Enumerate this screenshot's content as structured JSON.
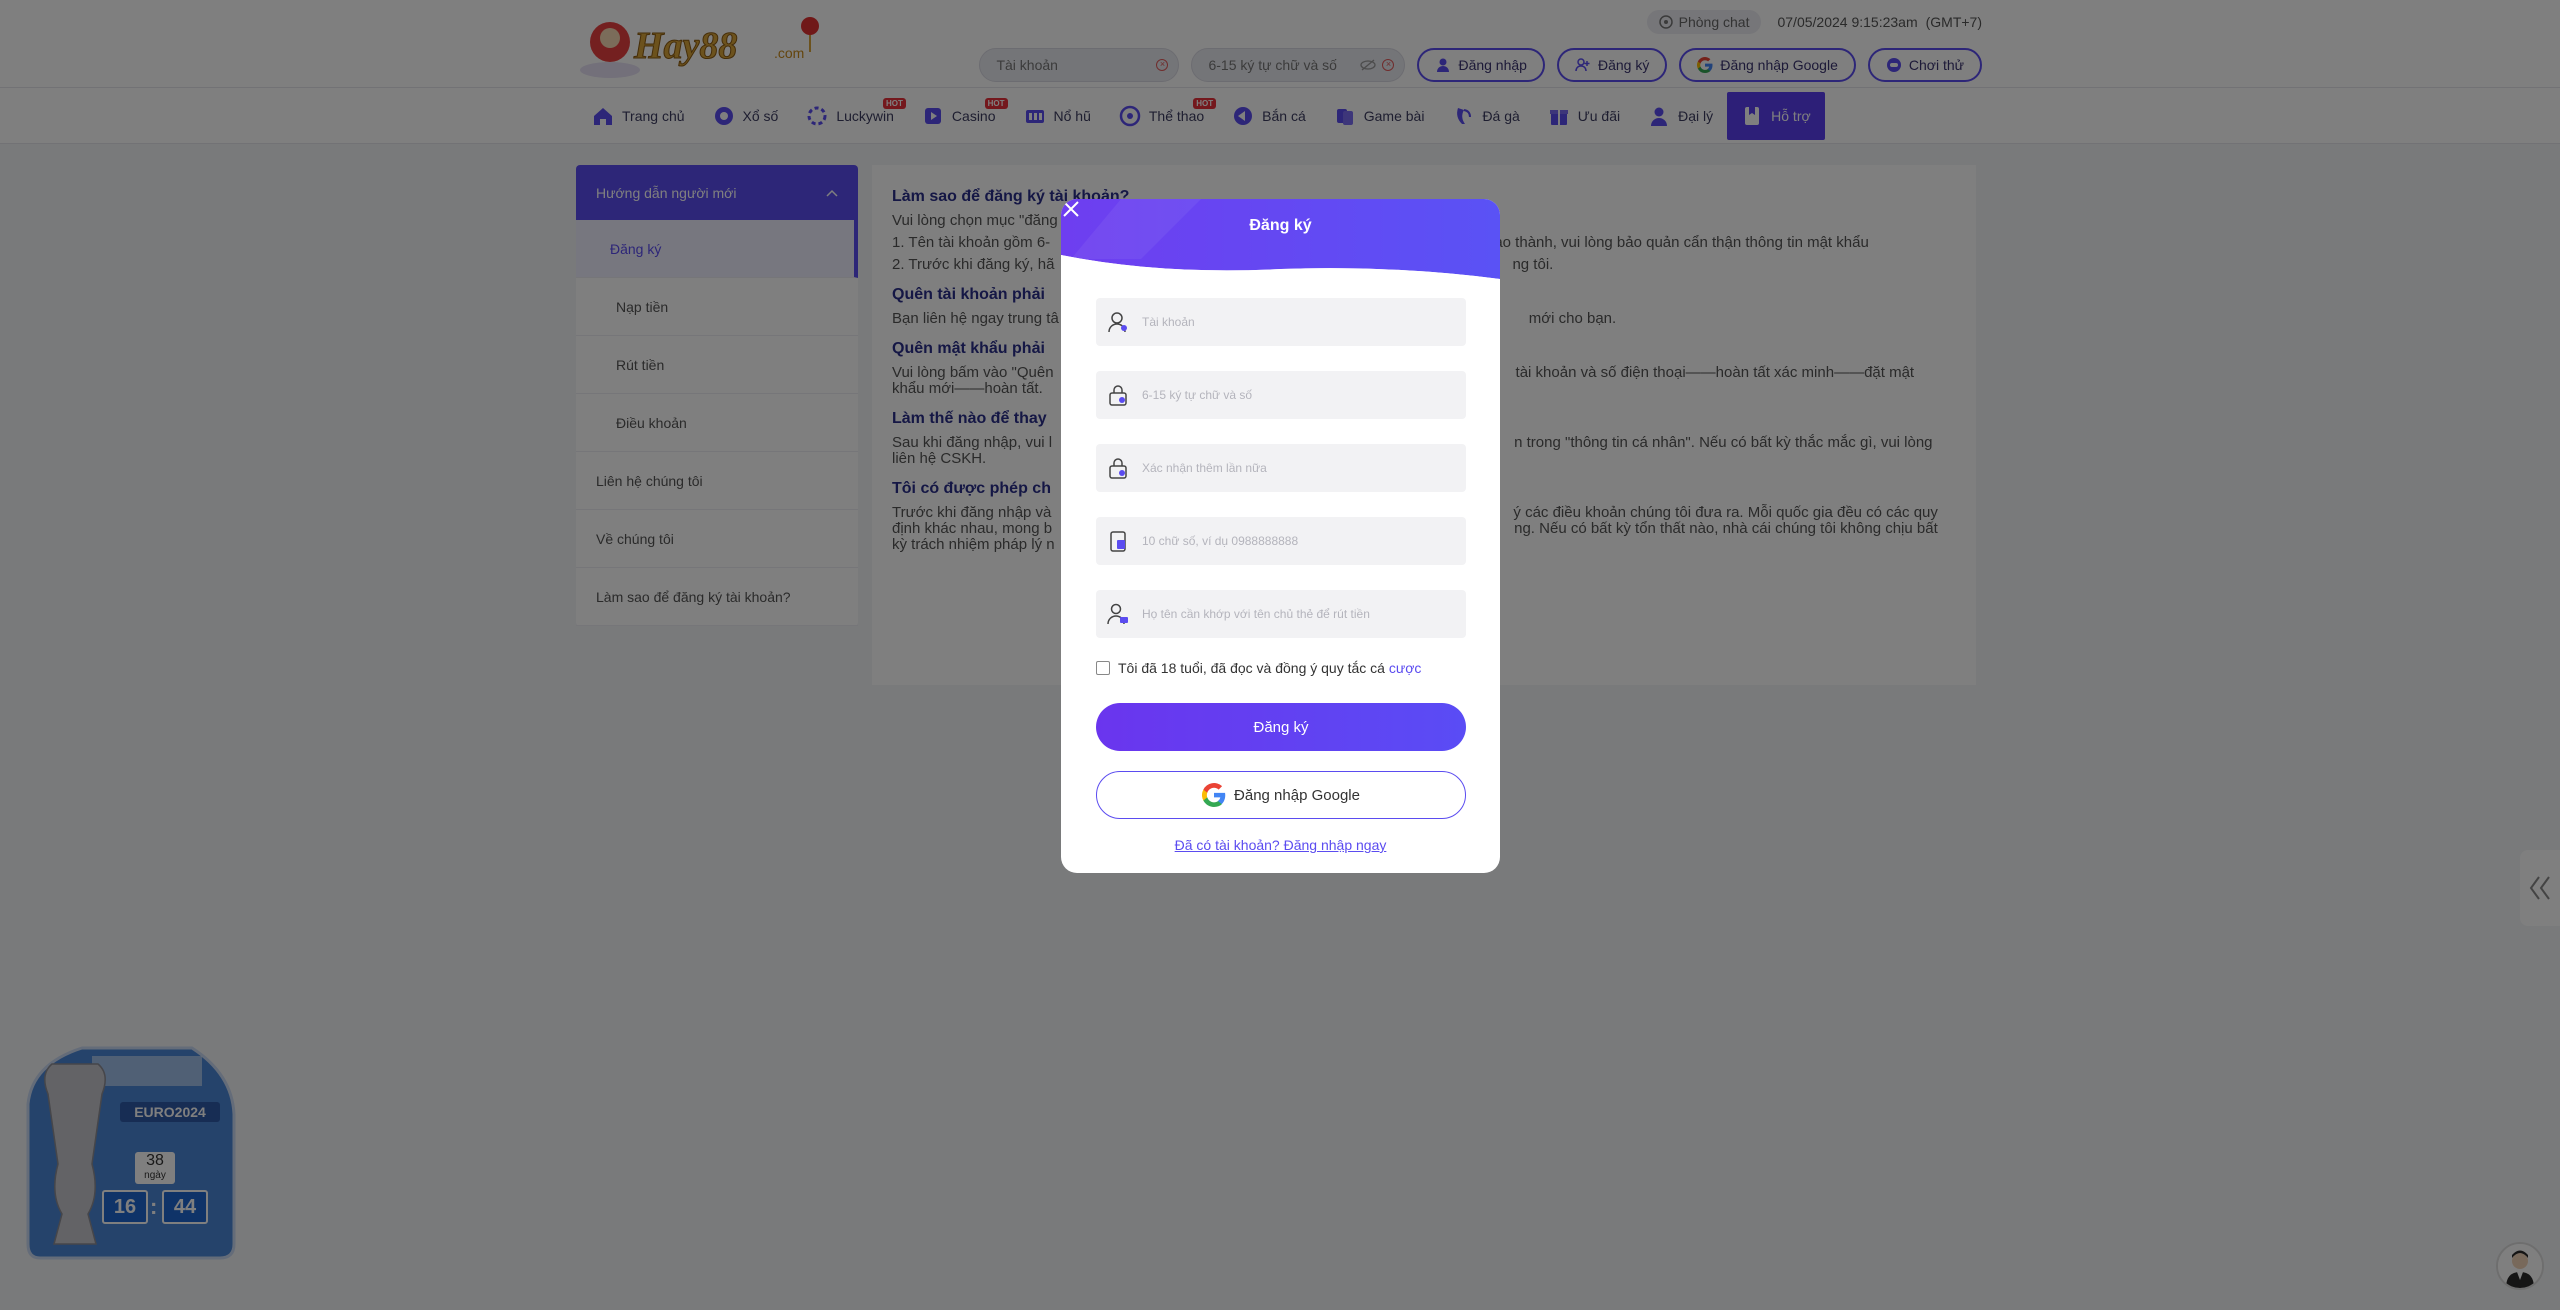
{
  "header": {
    "logo_text": "Hay88.com",
    "chat_label": "Phòng chat",
    "datetime": "07/05/2024 9:15:23am",
    "timezone": "(GMT+7)",
    "username_placeholder": "Tài khoản",
    "password_placeholder": "6-15 ký tự chữ và số",
    "login_label": "Đăng nhập",
    "register_label": "Đăng ký",
    "google_login_label": "Đăng nhập Google",
    "trial_label": "Chơi thử"
  },
  "nav": {
    "items": [
      {
        "label": "Trang chủ",
        "icon": "home-icon"
      },
      {
        "label": "Xổ số",
        "icon": "lottery-icon"
      },
      {
        "label": "Luckywin",
        "icon": "luckywin-icon",
        "badge": "HOT"
      },
      {
        "label": "Casino",
        "icon": "casino-icon",
        "badge": "HOT"
      },
      {
        "label": "Nổ hũ",
        "icon": "slots-icon"
      },
      {
        "label": "Thể thao",
        "icon": "sports-icon",
        "badge": "HOT"
      },
      {
        "label": "Bắn cá",
        "icon": "fish-icon"
      },
      {
        "label": "Game bài",
        "icon": "cards-icon"
      },
      {
        "label": "Đá gà",
        "icon": "cockfight-icon"
      },
      {
        "label": "Ưu đãi",
        "icon": "gift-icon"
      },
      {
        "label": "Đại lý",
        "icon": "agent-icon"
      },
      {
        "label": "Hỗ trợ",
        "icon": "support-icon",
        "active": true
      }
    ]
  },
  "sidebar": {
    "section_title": "Hướng dẫn người mới",
    "sub_items": [
      "Đăng ký",
      "Nạp tiền",
      "Rút tiền",
      "Điều khoản"
    ],
    "top_items": [
      "Liên hệ chúng tôi",
      "Về chúng tôi",
      "Làm sao để đăng ký tài khoản?"
    ]
  },
  "content": {
    "q1": "Làm sao để đăng ký tài khoản?",
    "p1a": "Vui lòng chọn mục \"đăng",
    "p1b": "1. Tên tài khoản gồm 6-",
    "p1b_tail": "số tạo thành, vui lòng bảo quản cẩn thận thông tin mật khẩu",
    "p1c": "2. Trước khi đăng ký, hã",
    "p1c_tail": "ng tôi.",
    "q2": "Quên tài khoản phải",
    "p2": "Bạn liên hệ ngay trung tâ",
    "p2_tail": "mới cho bạn.",
    "q3": "Quên mật khẩu phải",
    "p3": "Vui lòng bấm vào \"Quên",
    "p3_tail": "tài khoản và số điện thoại——hoàn tất xác minh——đặt mật",
    "p3_line2": "khẩu mới——hoàn tất.",
    "q4": "Làm thế nào để thay",
    "p4": "Sau khi đăng nhập, vui l",
    "p4_tail": "n trong \"thông tin cá nhân\". Nếu có bất kỳ thắc mắc gì, vui lòng",
    "p4_line2": "liên hệ CSKH.",
    "q5": "Tôi có được phép ch",
    "p5": "Trước khi đăng nhập và",
    "p5_tail": "ý các điều khoản chúng tôi đưa ra. Mỗi quốc gia đều có các quy",
    "p5_line2": "định khác nhau, mong b",
    "p5_line2_tail": "ng. Nếu có bất kỳ tổn thất nào, nhà cái chúng tôi không chịu bất",
    "p5_line3": "kỳ trách nhiệm pháp lý n"
  },
  "modal": {
    "title": "Đăng ký",
    "fields": [
      {
        "icon": "user-icon",
        "placeholder": "Tài khoản"
      },
      {
        "icon": "lock-icon",
        "placeholder": "6-15 ký tự chữ và số"
      },
      {
        "icon": "lock-icon",
        "placeholder": "Xác nhận thêm lần nữa"
      },
      {
        "icon": "phone-icon",
        "placeholder": "10 chữ số, ví dụ 0988888888"
      },
      {
        "icon": "id-user-icon",
        "placeholder": "Họ tên cần khớp với tên chủ thẻ để rút tiền"
      }
    ],
    "agree_text": "Tôi đã 18 tuổi, đã đọc và đồng ý quy tắc cá",
    "agree_link": "cược",
    "submit_label": "Đăng ký",
    "google_label": "Đăng nhập Google",
    "login_link": "Đã có tài khoản? Đăng nhập ngay"
  },
  "widget": {
    "event": "EURO2024",
    "days": "38",
    "days_label": "ngày",
    "hours": "16",
    "minutes": "44"
  },
  "colors": {
    "accent": "#5b4cf0",
    "modal_header": "#6a4bf2",
    "overlay": "rgba(0,0,0,0.5)"
  }
}
